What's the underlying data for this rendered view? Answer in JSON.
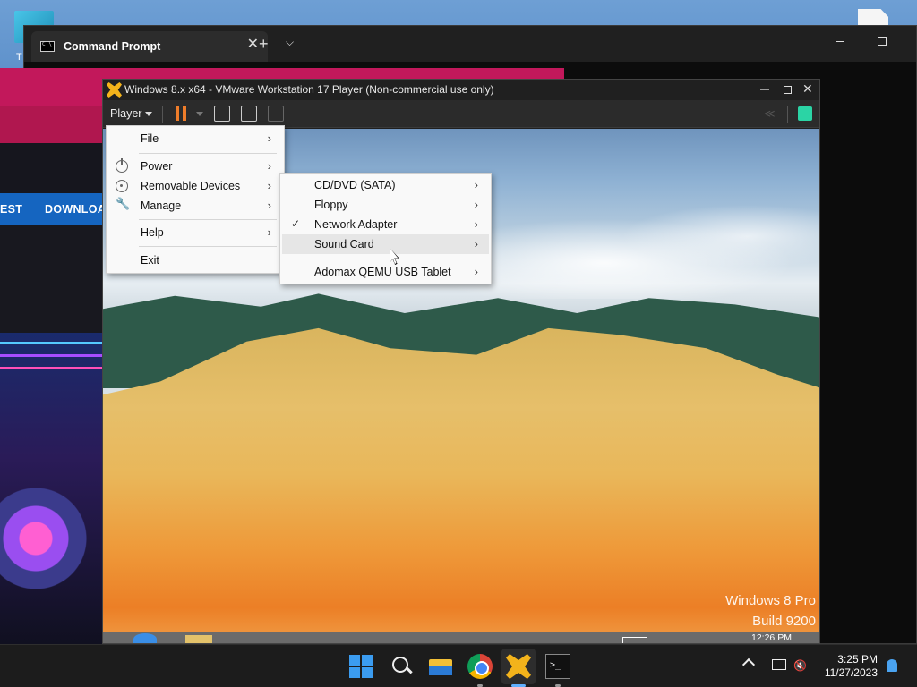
{
  "desktop": {
    "left_icon_label": "T"
  },
  "terminal": {
    "tab_title": "Command Prompt",
    "close_glyph": "✕",
    "new_tab_glyph": "+",
    "dropdown_glyph": "⌵"
  },
  "browser": {
    "nav_items": [
      "EST",
      "DOWNLOA"
    ]
  },
  "vmware": {
    "title": "Windows 8.x x64 - VMware Workstation 17 Player (Non-commercial use only)",
    "player_label": "Player",
    "guest": {
      "brand_line1": "Windows 8 Pro",
      "brand_line2": "Build 9200",
      "clock": "12:26 PM"
    }
  },
  "menu": {
    "items": [
      {
        "label": "File",
        "icon": "",
        "has_submenu": true
      },
      {
        "label": "Power",
        "icon": "power-icon",
        "has_submenu": true
      },
      {
        "label": "Removable Devices",
        "icon": "disc-icon",
        "has_submenu": true
      },
      {
        "label": "Manage",
        "icon": "wrench-icon",
        "has_submenu": true
      },
      {
        "label": "Help",
        "icon": "",
        "has_submenu": true
      },
      {
        "label": "Exit",
        "icon": "",
        "has_submenu": false
      }
    ],
    "arrow_glyph": "›"
  },
  "submenu": {
    "items": [
      {
        "label": "CD/DVD (SATA)",
        "checked": false,
        "highlighted": false
      },
      {
        "label": "Floppy",
        "checked": false,
        "highlighted": false
      },
      {
        "label": "Network Adapter",
        "checked": true,
        "highlighted": false
      },
      {
        "label": "Sound Card",
        "checked": false,
        "highlighted": true
      },
      {
        "label": "Adomax QEMU USB Tablet",
        "checked": false,
        "highlighted": false
      }
    ],
    "check_glyph": "✓"
  },
  "taskbar": {
    "apps": [
      "start-icon",
      "search-icon",
      "file-explorer-icon",
      "chrome-icon",
      "vmware-icon",
      "terminal-icon"
    ],
    "time": "3:25 PM",
    "date": "11/27/2023"
  },
  "colors": {
    "vmware_pause": "#ef7d2a",
    "vmware_logo": "#f3b31b",
    "browser_header": "#c2185b",
    "browser_nav": "#1565c0",
    "menu_highlight": "#e6e6e6"
  }
}
